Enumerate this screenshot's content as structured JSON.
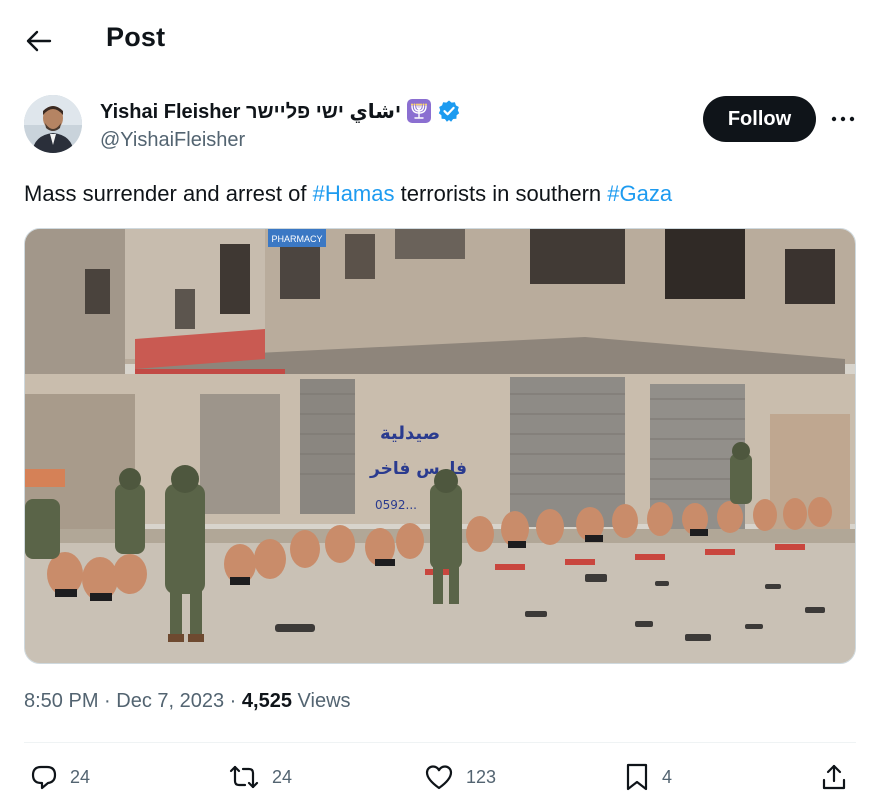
{
  "header": {
    "title": "Post"
  },
  "author": {
    "name": "Yishai Fleisher יشاي ישי פליישר",
    "handle": "@YishaiFleisher",
    "follow_label": "Follow"
  },
  "tweet": {
    "text_1": "Mass surrender and arrest of ",
    "hashtag_1": "#Hamas",
    "text_2": " terrorists in southern ",
    "hashtag_2": "#Gaza"
  },
  "photo": {
    "sign_text": "PHARMACY",
    "graffiti_1": "صيدلية",
    "graffiti_2": "فارس فاخر",
    "graffiti_3": "0592..."
  },
  "meta": {
    "time": "8:50 PM",
    "date": "Dec 7, 2023",
    "views_count": "4,525",
    "views_label": "Views"
  },
  "actions": {
    "replies": "24",
    "reposts": "24",
    "likes": "123",
    "bookmarks": "4"
  },
  "colors": {
    "accent": "#1d9bf0",
    "text": "#0f1419",
    "secondary": "#536471",
    "badge": "#8b6fd1"
  },
  "icons": [
    "back-arrow-icon",
    "menorah-icon",
    "verified-icon",
    "more-icon",
    "reply-icon",
    "repost-icon",
    "like-icon",
    "bookmark-icon",
    "share-icon"
  ]
}
